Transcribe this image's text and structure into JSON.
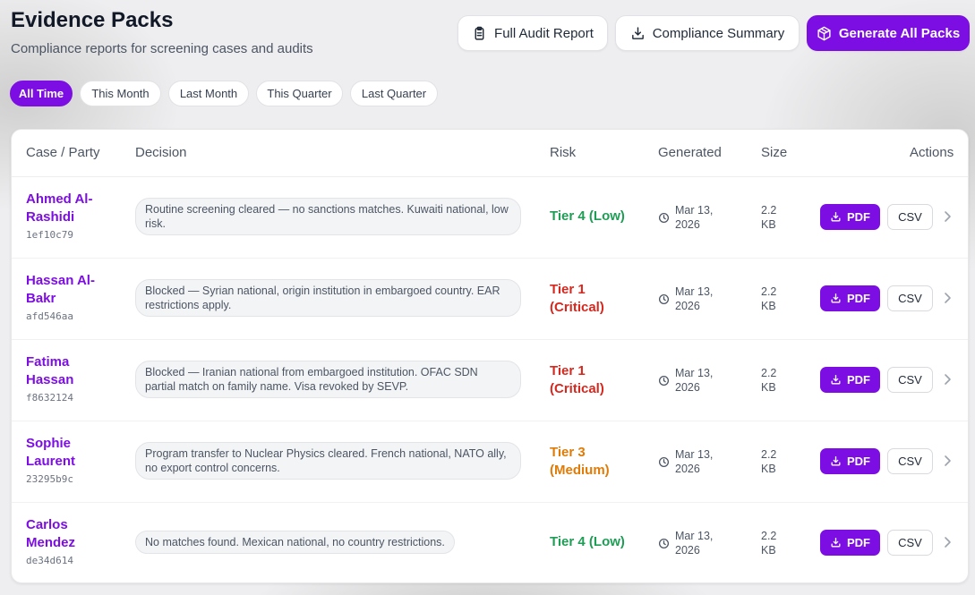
{
  "header": {
    "title": "Evidence Packs",
    "subtitle": "Compliance reports for screening cases and audits",
    "buttons": {
      "audit": "Full Audit Report",
      "summary": "Compliance Summary",
      "generate": "Generate All Packs"
    }
  },
  "filters": [
    "All Time",
    "This Month",
    "Last Month",
    "This Quarter",
    "Last Quarter"
  ],
  "table": {
    "columns": {
      "party": "Case / Party",
      "decision": "Decision",
      "risk": "Risk",
      "generated": "Generated",
      "size": "Size",
      "actions": "Actions"
    },
    "pdf_label": "PDF",
    "csv_label": "CSV",
    "rows": [
      {
        "name_line1": "Ahmed Al-",
        "name_line2": "Rashidi",
        "id": "1ef10c79",
        "decision": "Routine screening cleared — no sanctions matches. Kuwaiti national, low risk.",
        "risk_line1": "Tier 4 (Low)",
        "risk_line2": "",
        "date_line1": "Mar 13,",
        "date_line2": "2026",
        "size_line1": "2.2",
        "size_line2": "KB"
      },
      {
        "name_line1": "Hassan Al-",
        "name_line2": "Bakr",
        "id": "afd546aa",
        "decision": "Blocked — Syrian national, origin institution in embargoed country. EAR restrictions apply.",
        "risk_line1": "Tier 1",
        "risk_line2": "(Critical)",
        "date_line1": "Mar 13,",
        "date_line2": "2026",
        "size_line1": "2.2",
        "size_line2": "KB"
      },
      {
        "name_line1": "Fatima",
        "name_line2": "Hassan",
        "id": "f8632124",
        "decision": "Blocked — Iranian national from embargoed institution. OFAC SDN partial match on family name. Visa revoked by SEVP.",
        "risk_line1": "Tier 1",
        "risk_line2": "(Critical)",
        "date_line1": "Mar 13,",
        "date_line2": "2026",
        "size_line1": "2.2",
        "size_line2": "KB"
      },
      {
        "name_line1": "Sophie",
        "name_line2": "Laurent",
        "id": "23295b9c",
        "decision": "Program transfer to Nuclear Physics cleared. French national, NATO ally, no export control concerns.",
        "risk_line1": "Tier 3",
        "risk_line2": "(Medium)",
        "date_line1": "Mar 13,",
        "date_line2": "2026",
        "size_line1": "2.2",
        "size_line2": "KB"
      },
      {
        "name_line1": "Carlos",
        "name_line2": "Mendez",
        "id": "de34d614",
        "decision": "No matches found. Mexican national, no country restrictions.",
        "risk_line1": "Tier 4 (Low)",
        "risk_line2": "",
        "date_line1": "Mar 13,",
        "date_line2": "2026",
        "size_line1": "2.2",
        "size_line2": "KB"
      }
    ]
  },
  "colors": {
    "accent": "#7c0ee3",
    "risk_low": "#1f9d55",
    "risk_critical": "#d6281e",
    "risk_medium": "#e07b07"
  },
  "icons": {
    "audit": "clipboard-icon",
    "summary": "download-icon",
    "generate": "package-icon",
    "generated": "clock-icon",
    "pdf": "download-icon",
    "row_open": "chevron-right-icon"
  }
}
